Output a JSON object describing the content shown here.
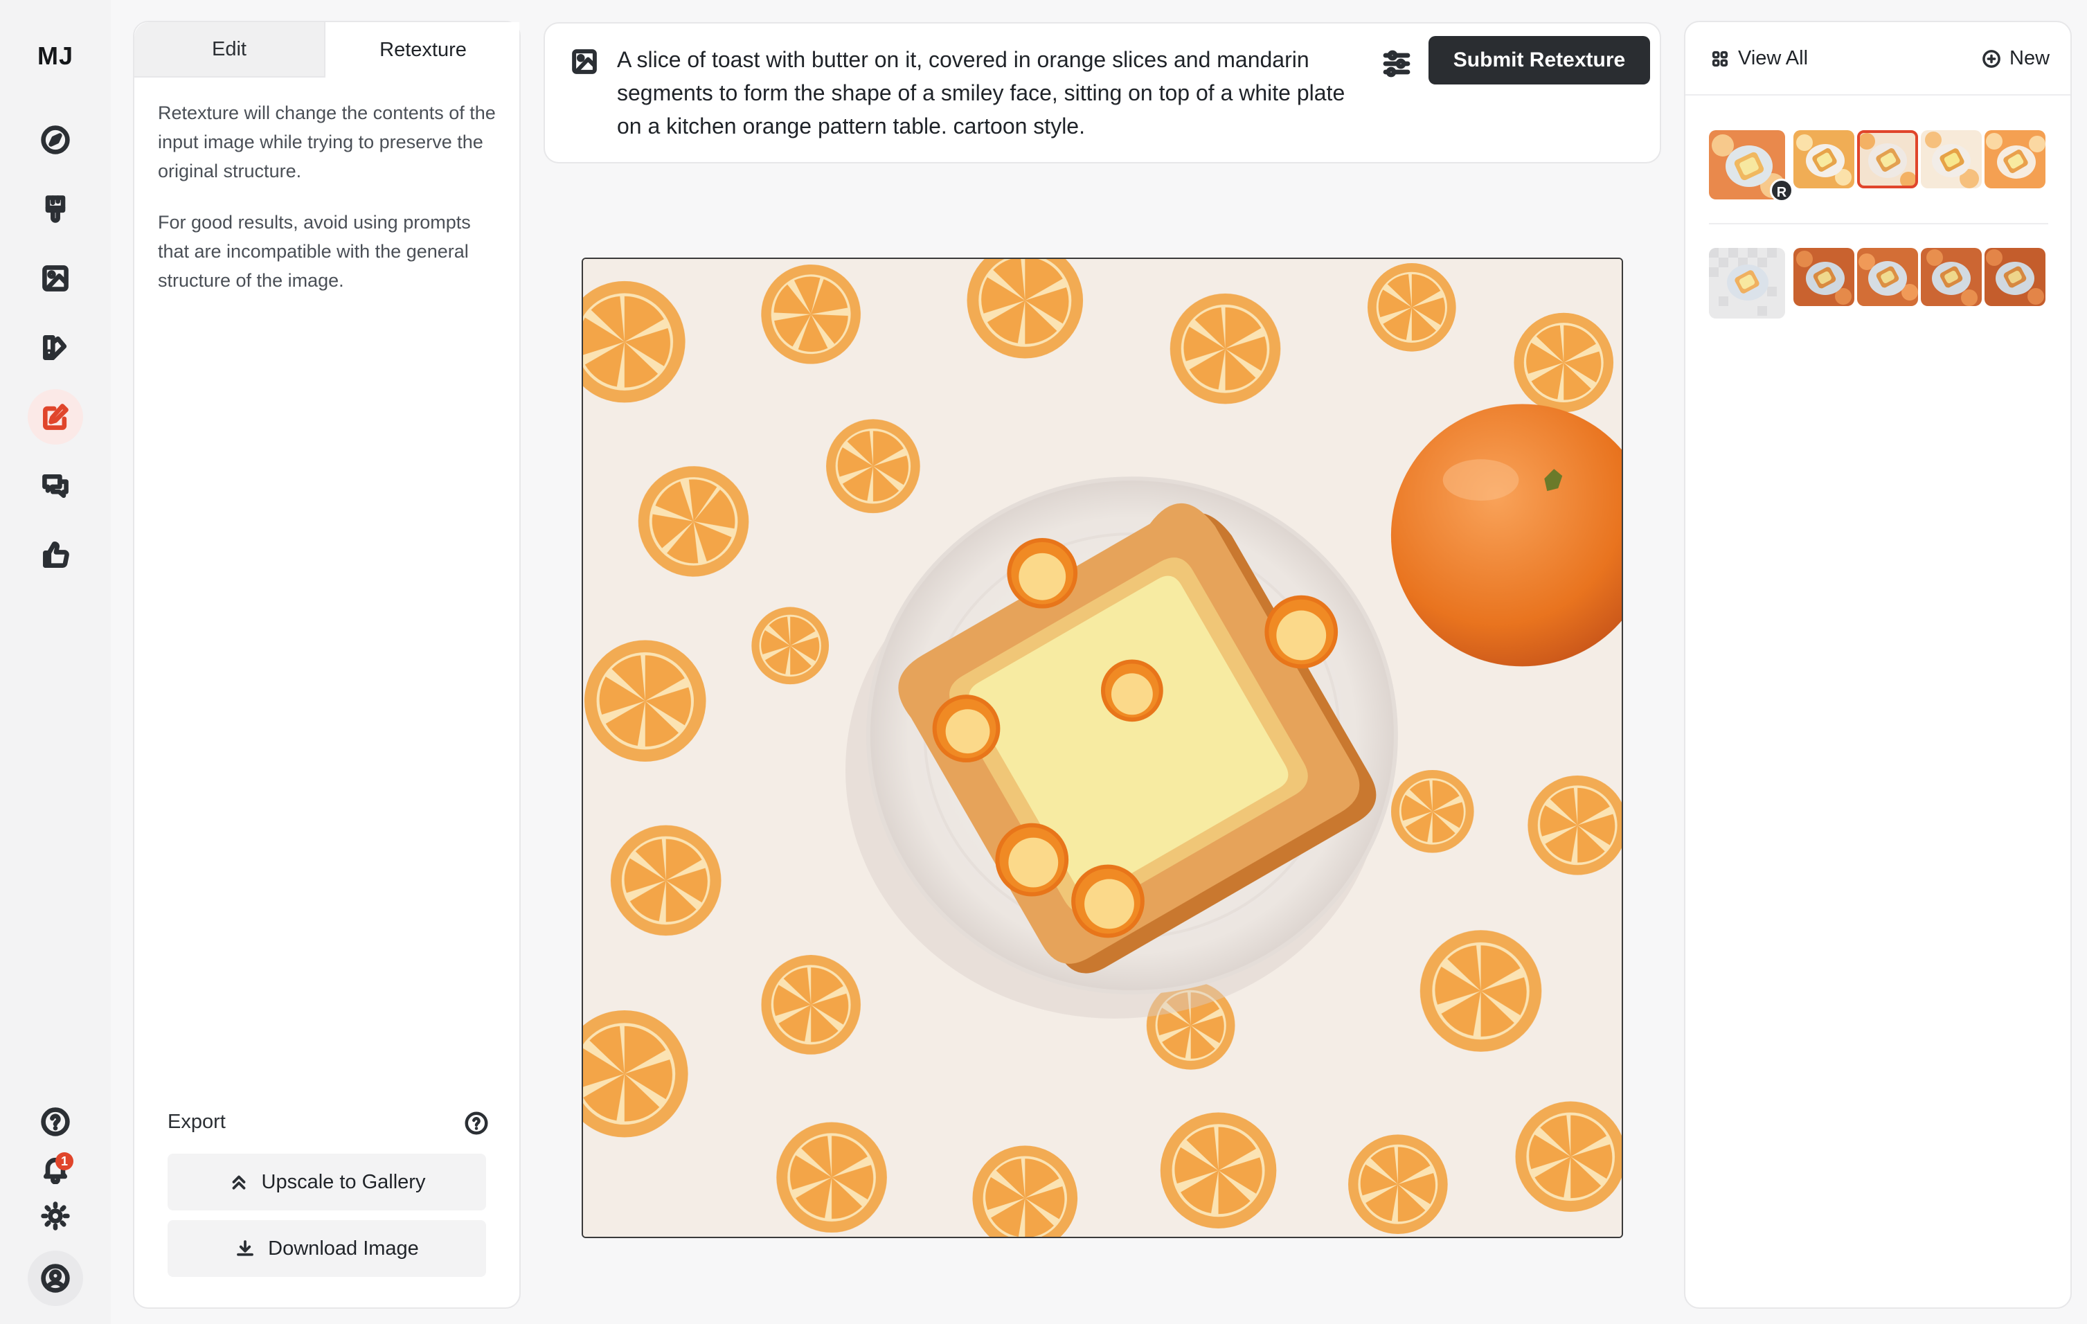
{
  "sidebar": {
    "logo": "MJ",
    "notification_count": "1",
    "nav_items": [
      "explore",
      "create",
      "organize",
      "personalize",
      "edit",
      "chat",
      "rank"
    ]
  },
  "left_panel": {
    "tabs": [
      {
        "label": "Edit",
        "active": false
      },
      {
        "label": "Retexture",
        "active": true
      }
    ],
    "description_1": "Retexture will change the contents of the input image while trying to preserve the original structure.",
    "description_2": "For good results, avoid using prompts that are incompatible with the general structure of the image.",
    "export_label": "Export",
    "upscale_label": "Upscale to Gallery",
    "download_label": "Download Image"
  },
  "prompt_bar": {
    "prompt_text": "A slice of toast with butter on it, covered in orange slices and mandarin segments to form the shape of a smiley face, sitting on top of a white plate on a kitchen orange pattern table. cartoon style.",
    "submit_label": "Submit Retexture"
  },
  "right_panel": {
    "view_all_label": "View All",
    "new_label": "New",
    "reference_badge": "R",
    "rows": [
      {
        "reference": "retexture-reference",
        "variations": 4,
        "selected_index": 1
      },
      {
        "reference": "retexture-reference",
        "variations": 4,
        "selected_index": -1
      }
    ]
  },
  "colors": {
    "accent": "#e0452b",
    "submit_bg": "#2a2d31",
    "orange": "#f2a13d",
    "butter": "#f7e89a"
  },
  "icons": [
    "compass-icon",
    "paintbrush-icon",
    "image-icon",
    "palette-icon",
    "edit-icon",
    "chat-icon",
    "thumbs-up-icon",
    "help-icon",
    "bell-icon",
    "sun-icon",
    "user-icon",
    "settings-icon",
    "grid-icon",
    "plus-circle-icon",
    "chevrons-up-icon",
    "download-icon"
  ]
}
